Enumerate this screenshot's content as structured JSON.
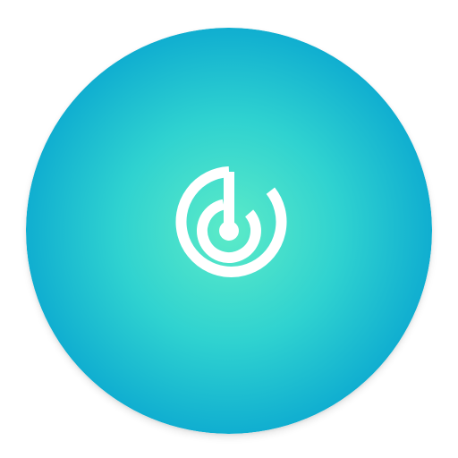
{
  "icon": {
    "semantic": "radar-target-icon",
    "colors": {
      "center": "#5cebc8",
      "mid": "#2fd2d0",
      "edge": "#10aed0",
      "glyph": "#ffffff"
    }
  }
}
